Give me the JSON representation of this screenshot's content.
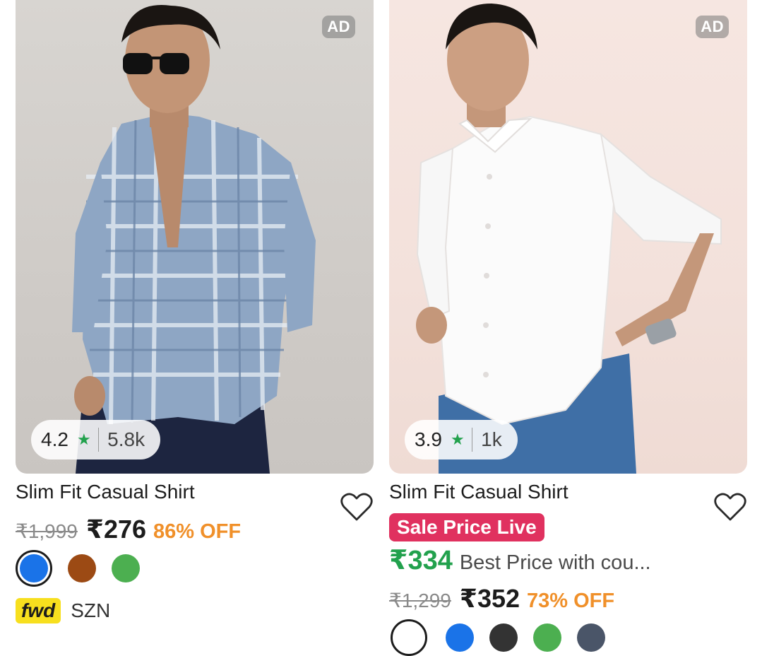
{
  "products": [
    {
      "ad_label": "AD",
      "rating": "4.2",
      "rating_count": "5.8k",
      "title": "Slim Fit Casual Shirt",
      "mrp": "₹1,999",
      "price": "₹276",
      "discount": "86% OFF",
      "swatches": [
        "#1a73e8",
        "#9c4a14",
        "#4caf50"
      ],
      "brand_logo": "fwd",
      "brand_name": "SZN",
      "icons": {
        "rating": "star-icon",
        "wishlist": "heart-icon"
      }
    },
    {
      "ad_label": "AD",
      "rating": "3.9",
      "rating_count": "1k",
      "title": "Slim Fit Casual Shirt",
      "sale_badge": "Sale Price Live",
      "coupon_price": "₹334",
      "coupon_text": "Best Price with cou...",
      "mrp": "₹1,299",
      "price": "₹352",
      "discount": "73% OFF",
      "icons": {
        "rating": "star-icon",
        "wishlist": "heart-icon"
      }
    }
  ],
  "colors": {
    "discount": "#f0902a",
    "rating_star": "#22a14d",
    "sale_badge": "#e0315f",
    "coupon_price": "#22a14d",
    "brand_logo_bg": "#f7df1e"
  }
}
